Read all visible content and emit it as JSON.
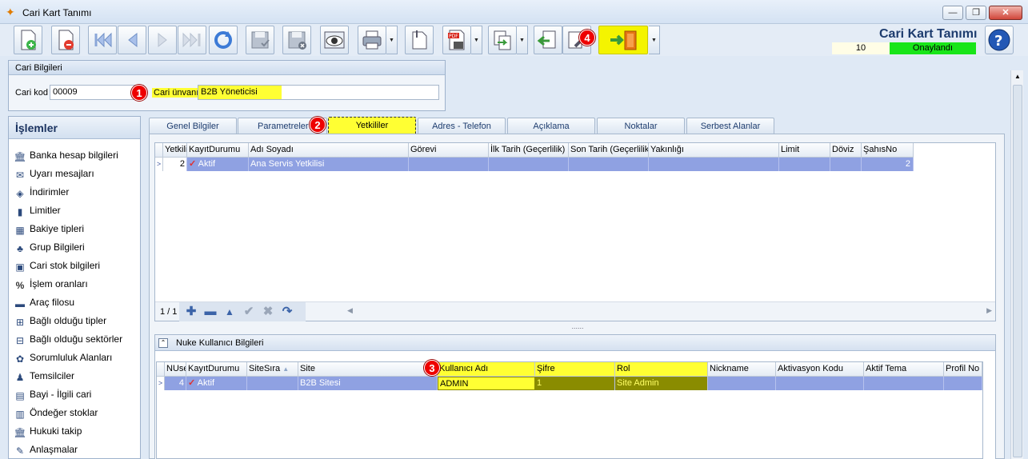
{
  "window": {
    "title": "Cari Kart Tanımı",
    "min": "—",
    "max": "❐",
    "close": "✕"
  },
  "header": {
    "title": "Cari Kart Tanımı",
    "number": "10",
    "status": "Onaylandı"
  },
  "cari": {
    "panel_title": "Cari Bilgileri",
    "kod_label": "Cari kod",
    "kod_value": "00009",
    "unvan_label": "Cari ünvanı",
    "unvan_value": "B2B Yöneticisi"
  },
  "badges": [
    "1",
    "2",
    "3",
    "4"
  ],
  "left_panel": {
    "title": "İşlemler",
    "items": [
      {
        "label": "Banka hesap bilgileri",
        "icon": "bank-icon"
      },
      {
        "label": "Uyarı mesajları",
        "icon": "message-icon"
      },
      {
        "label": "İndirimler",
        "icon": "tag-icon"
      },
      {
        "label": "Limitler",
        "icon": "limit-icon"
      },
      {
        "label": "Bakiye tipleri",
        "icon": "balance-icon"
      },
      {
        "label": "Grup Bilgileri",
        "icon": "group-icon"
      },
      {
        "label": "Cari stok bilgileri",
        "icon": "stock-icon"
      },
      {
        "label": "İşlem oranları",
        "icon": "percent-icon"
      },
      {
        "label": "Araç filosu",
        "icon": "vehicle-icon"
      },
      {
        "label": "Bağlı olduğu tipler",
        "icon": "type-icon"
      },
      {
        "label": "Bağlı olduğu sektörler",
        "icon": "sector-icon"
      },
      {
        "label": "Sorumluluk Alanları",
        "icon": "responsibility-icon"
      },
      {
        "label": "Temsilciler",
        "icon": "person-icon"
      },
      {
        "label": "Bayi - İlgili cari",
        "icon": "dealer-icon"
      },
      {
        "label": "Öndeğer stoklar",
        "icon": "default-stock-icon"
      },
      {
        "label": "Hukuki takip",
        "icon": "legal-icon"
      },
      {
        "label": "Anlaşmalar",
        "icon": "agreement-icon"
      }
    ]
  },
  "tabs": [
    "Genel Bilgiler",
    "Parametreler",
    "Yetkililer",
    "Adres - Telefon",
    "Açıklama",
    "Noktalar",
    "Serbest Alanlar"
  ],
  "grid1": {
    "headers": [
      "Yetkili",
      "KayıtDurumu",
      "Adı Soyadı",
      "Görevi",
      "İlk Tarih (Geçerlilik)",
      "Son Tarih (Geçerlilik)",
      "Yakınlığı",
      "Limit",
      "Döviz",
      "ŞahısNo"
    ],
    "row": [
      "2",
      "Aktif",
      "Ana Servis Yetkilisi",
      "",
      "",
      "",
      "",
      "",
      "",
      "2"
    ],
    "page_info": "1 / 1"
  },
  "grid2": {
    "panel_title": "Nuke Kullanıcı Bilgileri",
    "headers": [
      "NUser",
      "KayıtDurumu",
      "SiteSıra",
      "Site",
      "Kullanıcı Adı",
      "Şifre",
      "Rol",
      "Nickname",
      "Aktivasyon Kodu",
      "Aktif Tema",
      "Profil No"
    ],
    "row": [
      "4",
      "Aktif",
      "",
      "B2B Sitesi",
      "ADMIN",
      "1",
      "Site Admin",
      "",
      "",
      "",
      ""
    ]
  },
  "colors": {
    "highlight": "#ffff33",
    "selected_row": "#8fa1e2",
    "status_green": "#19e519",
    "badge_red": "#e00000"
  }
}
